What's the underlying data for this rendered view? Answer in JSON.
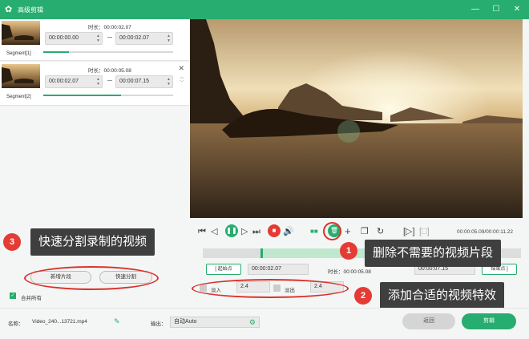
{
  "window": {
    "title": "高级剪辑"
  },
  "segments": [
    {
      "label": "Segment[1]",
      "duration_label": "时长：00:00:02.07",
      "start": "00:00:00.00",
      "end": "00:00:02.07",
      "progress": 0.2
    },
    {
      "label": "Segment[2]",
      "duration_label": "时长：00:00:05.08",
      "start": "00:00:02.07",
      "end": "00:00:07.15",
      "progress": 0.6
    }
  ],
  "player": {
    "timecode": "00:00:05.09/00:00:11.22"
  },
  "clip": {
    "start_btn": "起始点",
    "start_time": "00:00:02.07",
    "duration_label": "时长：00:00:05.08",
    "end_time": "00:00:07.15",
    "end_btn": "结束点"
  },
  "effects": {
    "fade_in_label": "淡入",
    "fade_in_value": "2.4",
    "fade_out_label": "淡出",
    "fade_out_value": "2.4"
  },
  "left_actions": {
    "add_segment": "新增片段",
    "quick_split": "快速分割",
    "merge_all": "合并所有"
  },
  "annotations": {
    "n1": "1",
    "t1": "删除不需要的视频片段",
    "n2": "2",
    "t2": "添加合适的视频特效",
    "n3": "3",
    "t3": "快速分割录制的视频"
  },
  "footer": {
    "name_label": "名称：",
    "filename": "Video_240...13721.mp4",
    "output_label": "输出：",
    "output_value": "自动Auto",
    "back": "返回",
    "cut": "剪辑"
  },
  "colors": {
    "accent": "#27ad6f",
    "annotation_red": "#e43b35"
  }
}
